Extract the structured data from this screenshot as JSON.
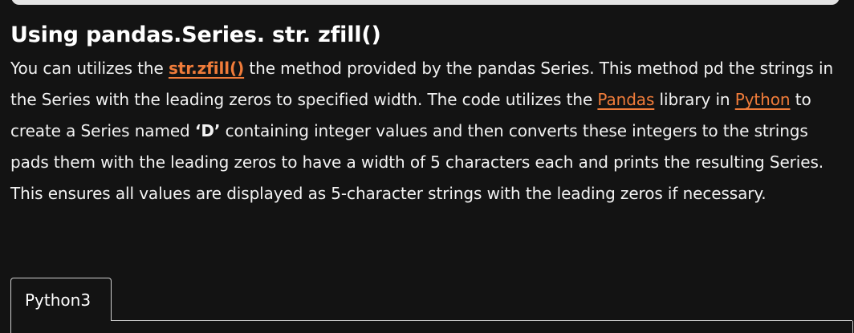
{
  "article": {
    "heading": "Using pandas.Series. str. zfill()",
    "paragraph": {
      "t1": "You can utilizes the ",
      "link1": "str.zfill()",
      "t2": " the method provided by the pandas Series. This method pd the strings in the Series with the leading zeros to specified width. The code utilizes the ",
      "link2": "Pandas",
      "t3": " library in ",
      "link3": "Python",
      "t4": " to create a Series named ",
      "bold1": "‘D’",
      "t5": " containing integer values and then converts these integers to the strings pads them with the leading zeros to have a width of 5 characters each and prints the resulting Series. This ensures all values are displayed as 5-character strings with the leading zeros if necessary."
    }
  },
  "code_tabs": {
    "active_tab": "Python3"
  },
  "colors": {
    "background": "#131313",
    "link": "#f07c3a",
    "text": "#ffffff"
  }
}
